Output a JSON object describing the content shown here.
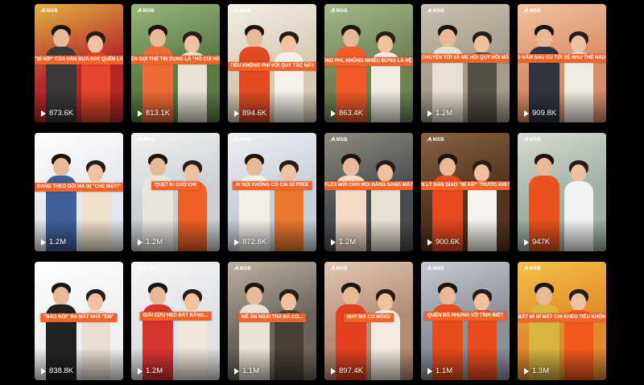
{
  "brand": {
    "logo_text": "MSB",
    "logo_mark": "ᗑ"
  },
  "videos": [
    {
      "caption": "\"BÍ KÍP\" CỦA HẢN ĐỰA HAY QUÊN LÀ",
      "views": "873.6K",
      "bg": "#b5282a",
      "accent": "#e3b341",
      "shirt1": "#3a3a3a",
      "shirt2": "#e5452c"
    },
    {
      "caption": "NÊN GỌI THẺ TÍN DỤNG LÀ \"HỎ CỦI HỒI\"",
      "views": "813.1K",
      "bg": "#5b7a46",
      "accent": "#9bb77c",
      "shirt1": "#f06a35",
      "shirt2": "#e9e3d6"
    },
    {
      "caption": "TIỀU KHÔNG PHÍ VỚI QUY TẮC NÀY",
      "views": "894.6K",
      "bg": "#d8cbb4",
      "accent": "#f2efe8",
      "shirt1": "#e24a24",
      "shirt2": "#f4f1ea"
    },
    {
      "caption": "KHÔNG PHÍ, KHÔNG NHIỀU ĐỪNG LÀ HỆ RỒI",
      "views": "863.4K",
      "bg": "#6e8254",
      "accent": "#a7b88a",
      "shirt1": "#f05a28",
      "shirt2": "#f1ebe2"
    },
    {
      "caption": "CHUYỆN TỚI VÀ MẸ HỎI QUY HỒI MÃ",
      "views": "1.2M",
      "bg": "#a59c8b",
      "accent": "#c9c1b1",
      "shirt1": "#e8e0d2",
      "shirt2": "#555046"
    },
    {
      "caption": "10 NĂM SAU CÙ TỚI SẼ NHƯ THẾ NÀO?",
      "views": "909.8K",
      "bg": "#d98d68",
      "accent": "#f3c3a1",
      "shirt1": "#2f3440",
      "shirt2": "#efeae2"
    },
    {
      "caption": "ĐANG THEO DÕI MÀ BỊ \"CHE MẶT!\"",
      "views": "1.2M",
      "bg": "#e4e8ec",
      "accent": "#ffffff",
      "shirt1": "#3f5f9b",
      "shirt2": "#efe2cc"
    },
    {
      "caption": "QUẸT ĐI CHỜ CHI",
      "views": "1.2M",
      "bg": "#ccd0d3",
      "accent": "#f1f2f2",
      "shirt1": "#e8e5de",
      "shirt2": "#f05f26"
    },
    {
      "caption": "AI NÓI KHÔNG CÓ CÁI GÌ FREE",
      "views": "872.8K",
      "bg": "#c7cfd8",
      "accent": "#eef1f4",
      "shirt1": "#f2efe8",
      "shirt2": "#e9782c"
    },
    {
      "caption": "FLEX MỚI CHO MỌI HÀNG SANG MẮT",
      "views": "1.2M",
      "bg": "#4a4d50",
      "accent": "#8e8b80",
      "shirt1": "#f4d9c6",
      "shirt2": "#e9e1d4"
    },
    {
      "caption": "QUẢN LÝ BẢN GIAO \"BÍ KÍP\" TRƯỚC KHI NGHỈ",
      "views": "900.6K",
      "bg": "#51341f",
      "accent": "#8a6240",
      "shirt1": "#e8491f",
      "shirt2": "#f6f3ee"
    },
    {
      "caption": "",
      "views": "947K",
      "bg": "#9fb0a4",
      "accent": "#d9dcd3",
      "shirt1": "#e9521c",
      "shirt2": "#f2f2f2"
    },
    {
      "caption": "\"BẢO BỐI\" RA MẮT NHÀ \"EM\"",
      "views": "838.8K",
      "bg": "#eef0f1",
      "accent": "#ffffff",
      "shirt1": "#232323",
      "shirt2": "#e8dfd2"
    },
    {
      "caption": "GIẢI CỨU HEO ĐẤT BẰNG...",
      "views": "1.2M",
      "bg": "#dfe2e5",
      "accent": "#f6f7f8",
      "shirt1": "#d8342f",
      "shirt2": "#efe6d8"
    },
    {
      "caption": "MỀ ĂN NGẠI TRẢ ĐÃ CÓ...",
      "views": "1.1M",
      "bg": "#6a645b",
      "accent": "#bdb3a2",
      "shirt1": "#e9e2d5",
      "shirt2": "#4a4035"
    },
    {
      "caption": "MAY MÀ CÓ MOIGI",
      "views": "897.4K",
      "bg": "#b48b74",
      "accent": "#e1c8b7",
      "shirt1": "#e4401f",
      "shirt2": "#f5eadf"
    },
    {
      "caption": "QUÊN ĐÓ NHƯNG VỠ TÌNH BIẾT",
      "views": "1.1M",
      "bg": "#8a8f98",
      "accent": "#c7ccd3",
      "shirt1": "#ea4b1d",
      "shirt2": "#ea4b1d"
    },
    {
      "caption": "BẮT MÍ BÍ MẬT CHỊ KHÉO TIÊU KHÔN",
      "views": "1.3M",
      "bg": "#e08a2a",
      "accent": "#f6c24a",
      "shirt1": "#d9b441",
      "shirt2": "#f05a1d"
    }
  ]
}
